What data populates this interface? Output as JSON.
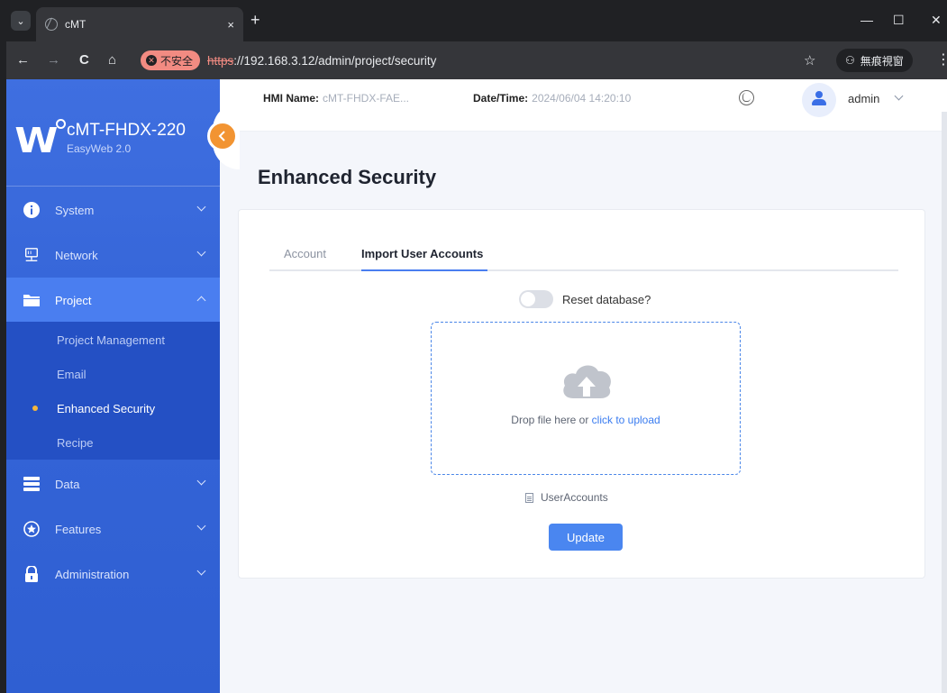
{
  "browser": {
    "tab_title": "cMT",
    "tab_close": "×",
    "new_tab": "+",
    "security_label": "不安全",
    "url_scheme": "https",
    "url_rest": "://192.168.3.12/admin/project/security",
    "incognito_label": "無痕視窗",
    "nav_back": "←",
    "nav_forward": "→",
    "nav_reload": "C",
    "nav_home": "⌂",
    "bookmark_star": "☆",
    "menu": "⋮",
    "minimize": "—",
    "maximize": "☐",
    "close": "✕"
  },
  "brand": {
    "model": "cMT-FHDX-220",
    "version": "EasyWeb 2.0"
  },
  "sidebar": {
    "items": [
      {
        "label": "System",
        "icon": "info-icon"
      },
      {
        "label": "Network",
        "icon": "network-icon"
      },
      {
        "label": "Project",
        "icon": "folder-icon"
      },
      {
        "label": "Data",
        "icon": "database-icon"
      },
      {
        "label": "Features",
        "icon": "star-badge-icon"
      },
      {
        "label": "Administration",
        "icon": "lock-icon"
      }
    ],
    "project_sub": [
      {
        "label": "Project Management"
      },
      {
        "label": "Email"
      },
      {
        "label": "Enhanced Security"
      },
      {
        "label": "Recipe"
      }
    ]
  },
  "topbar": {
    "hmi_label": "HMI Name:",
    "hmi_value": "cMT-FHDX-FAE...",
    "datetime_label": "Date/Time:",
    "datetime_value": "2024/06/04 14:20:10",
    "user": "admin"
  },
  "page": {
    "title": "Enhanced Security",
    "tabs": [
      {
        "label": "Account",
        "active": false
      },
      {
        "label": "Import User Accounts",
        "active": true
      }
    ],
    "reset_label": "Reset database?",
    "reset_on": false,
    "drop_text": "Drop file here or ",
    "drop_link": "click to upload",
    "file_name": "UserAccounts",
    "update_label": "Update"
  },
  "colors": {
    "sidebar": "#3565d8",
    "accent": "#4a86f0",
    "collapse": "#f29432",
    "active_dot": "#f6b73c"
  }
}
